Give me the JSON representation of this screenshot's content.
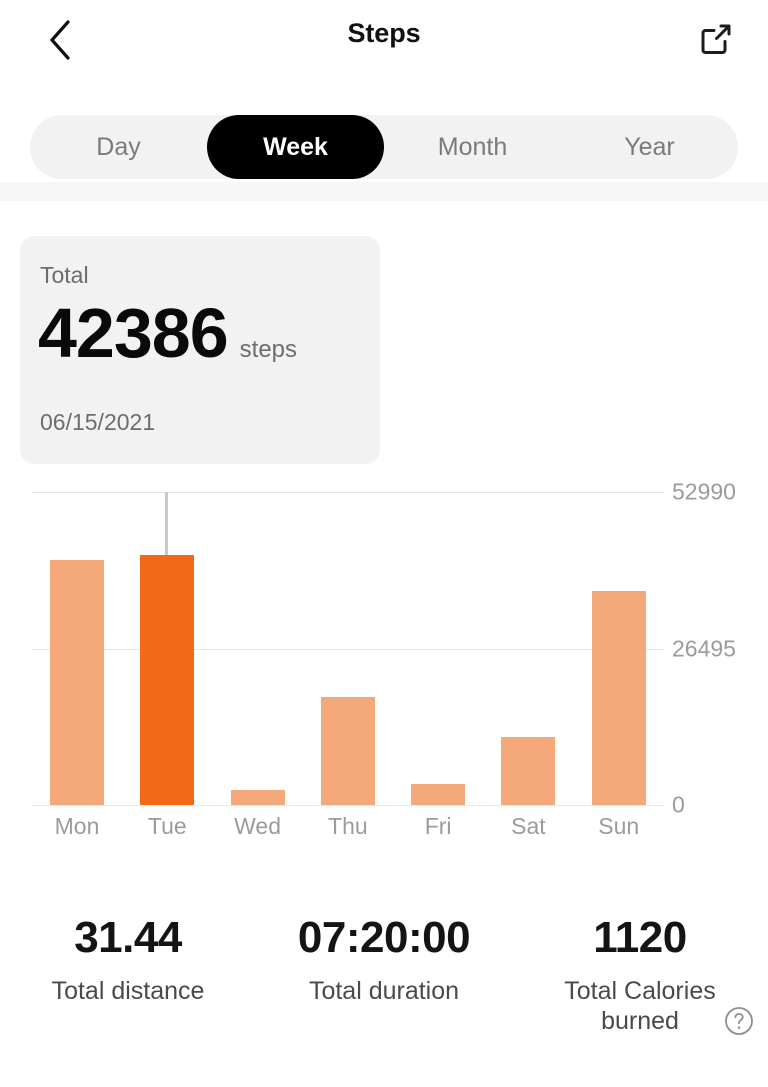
{
  "header": {
    "title": "Steps",
    "back_icon": "chevron-left-icon",
    "share_icon": "share-external-icon"
  },
  "range_tabs": {
    "items": [
      {
        "label": "Day",
        "active": false
      },
      {
        "label": "Week",
        "active": true
      },
      {
        "label": "Month",
        "active": false
      },
      {
        "label": "Year",
        "active": false
      }
    ]
  },
  "total_card": {
    "label": "Total",
    "value": "42386",
    "unit": "steps",
    "date": "06/15/2021"
  },
  "chart_data": {
    "type": "bar",
    "title": "",
    "xlabel": "",
    "ylabel": "",
    "categories": [
      "Mon",
      "Tue",
      "Wed",
      "Thu",
      "Fri",
      "Sat",
      "Sun"
    ],
    "values": [
      41500,
      42386,
      2500,
      18300,
      3600,
      11500,
      36200
    ],
    "ylim": [
      0,
      52990
    ],
    "ytick_labels": [
      "52990",
      "26495",
      "0"
    ],
    "ytick_values": [
      52990,
      26495,
      0
    ],
    "grid": true,
    "legend": "none",
    "selected_index": 1,
    "colors": {
      "bar": "#f5a87a",
      "bar_selected": "#f26a18",
      "gridline": "#e8e8e8",
      "tick_text": "#9b9b9b",
      "indicator": "#c9c9c9"
    }
  },
  "stats": {
    "items": [
      {
        "value": "31.44",
        "label": "Total distance"
      },
      {
        "value": "07:20:00",
        "label": "Total duration"
      },
      {
        "value": "1120",
        "label": "Total Calories burned"
      }
    ],
    "help_icon": "help-circle-icon"
  },
  "theme": {
    "accent": "#f26a18",
    "accent_light": "#f5a87a",
    "background": "#ffffff",
    "card_background": "#f2f2f2",
    "active_tab_background": "#000000"
  }
}
